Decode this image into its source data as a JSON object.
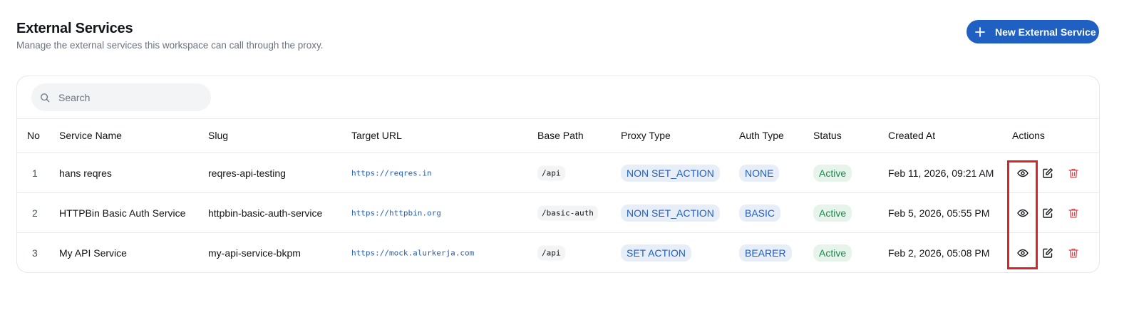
{
  "header": {
    "title": "External Services",
    "subtitle": "Manage the external services this workspace can call through the proxy.",
    "new_button_label": "New External Service"
  },
  "search": {
    "placeholder": "Search"
  },
  "table": {
    "columns": [
      "No",
      "Service Name",
      "Slug",
      "Target URL",
      "Base Path",
      "Proxy Type",
      "Auth Type",
      "Status",
      "Created At",
      "Actions"
    ],
    "rows": [
      {
        "no": "1",
        "name": "hans reqres",
        "slug": "reqres-api-testing",
        "url": "https://reqres.in",
        "base_path": "/api",
        "proxy_type": "NON SET_ACTION",
        "auth_type": "NONE",
        "status": "Active",
        "created_at": "Feb 11, 2026, 09:21 AM"
      },
      {
        "no": "2",
        "name": "HTTPBin Basic Auth Service",
        "slug": "httpbin-basic-auth-service",
        "url": "https://httpbin.org",
        "base_path": "/basic-auth",
        "proxy_type": "NON SET_ACTION",
        "auth_type": "BASIC",
        "status": "Active",
        "created_at": "Feb 5, 2026, 05:55 PM"
      },
      {
        "no": "3",
        "name": "My API Service",
        "slug": "my-api-service-bkpm",
        "url": "https://mock.alurkerja.com",
        "base_path": "/api",
        "proxy_type": "SET ACTION",
        "auth_type": "BEARER",
        "status": "Active",
        "created_at": "Feb 2, 2026, 05:08 PM"
      }
    ],
    "row_actions": [
      "eye-icon",
      "edit-icon",
      "trash-icon"
    ]
  },
  "colors": {
    "primary": "#2060c2",
    "status_active": "#1f8a4c",
    "danger": "#e5484d",
    "highlight_box": "#d7262b"
  }
}
